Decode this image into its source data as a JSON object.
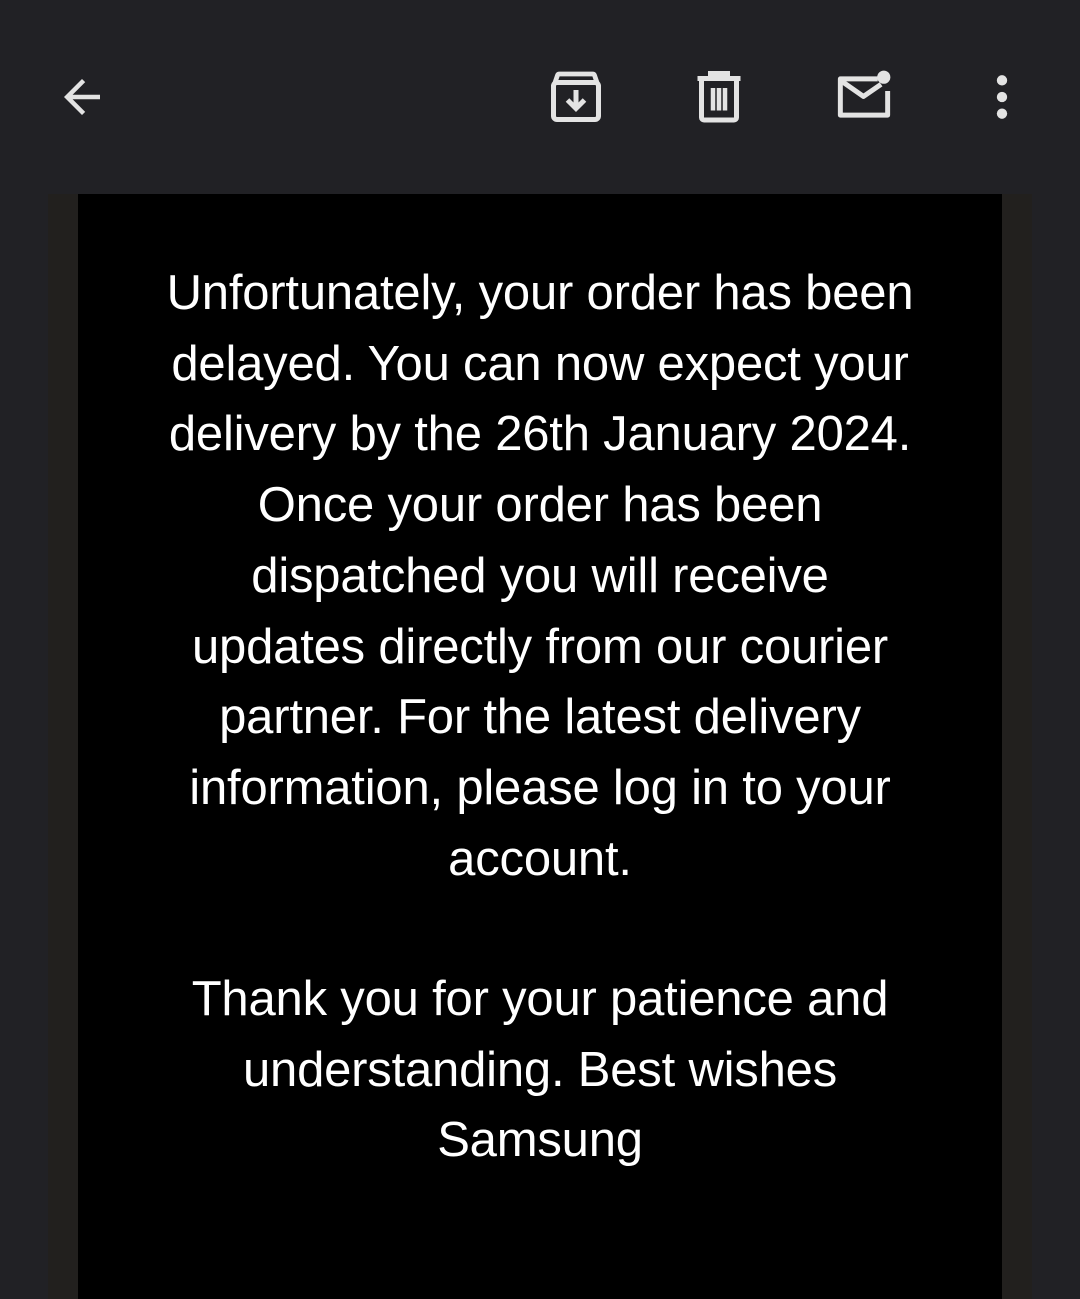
{
  "toolbar": {
    "icons": {
      "back": "arrow-back-icon",
      "archive": "archive-icon",
      "delete": "trash-icon",
      "mark_unread": "mark-unread-icon",
      "more": "more-vertical-icon"
    }
  },
  "email": {
    "body_lines": [
      "Unfortunately, your order has been",
      "delayed. You can now expect your",
      "delivery by the 26th January 2024.",
      "Once your order has been",
      "dispatched you will receive",
      "updates directly from our courier",
      "partner. For the latest delivery",
      "information, please log in to your",
      "account."
    ],
    "closing_lines": [
      "Thank you for your patience and",
      "understanding. Best wishes",
      "Samsung"
    ]
  },
  "colors": {
    "toolbar_bg": "#212125",
    "email_bg": "#000000",
    "frame_bg": "#22201e",
    "text": "#ffffff",
    "icon": "#e3e3e3"
  }
}
